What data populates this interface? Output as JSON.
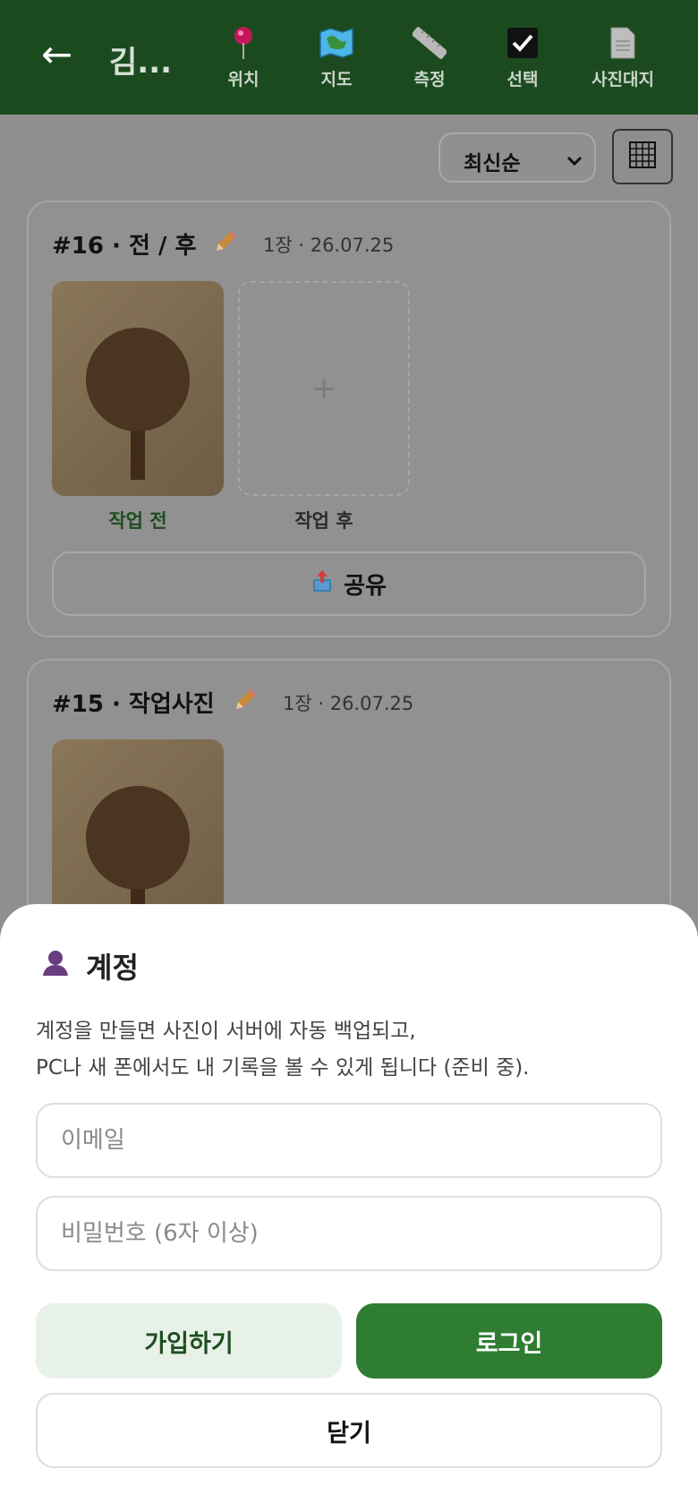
{
  "header": {
    "back_glyph": "←",
    "title": "김...",
    "actions": [
      {
        "label": "위치",
        "icon": "pushpin-icon"
      },
      {
        "label": "지도",
        "icon": "map-icon"
      },
      {
        "label": "측정",
        "icon": "ruler-icon"
      },
      {
        "label": "선택",
        "icon": "checkbox-icon"
      },
      {
        "label": "사진대지",
        "icon": "document-icon"
      }
    ],
    "bg_color": "#1c4a1f"
  },
  "toolbar": {
    "sort_value": "최신순",
    "sort_options": [
      "최신순"
    ],
    "grid_icon": "grid-icon"
  },
  "cards": [
    {
      "title": "#16 · 전 / 후",
      "meta": "1장 · 26.07.25",
      "before_label": "작업 전",
      "after_label": "작업 후",
      "add_glyph": "+",
      "share_label": "공유"
    },
    {
      "title": "#15 · 작업사진",
      "meta": "1장 · 26.07.25"
    }
  ],
  "account_sheet": {
    "title": "계정",
    "icon": "user-icon",
    "description_line1": "계정을 만들면 사진이 서버에 자동 백업되고,",
    "description_line2": "PC나 새 폰에서도 내 기록을 볼 수 있게 됩니다 (준비 중).",
    "email_placeholder": "이메일",
    "password_placeholder": "비밀번호 (6자 이상)",
    "signup_label": "가입하기",
    "login_label": "로그인",
    "close_label": "닫기",
    "accent_color": "#2e7d32",
    "signup_bg": "#e8f1e7"
  }
}
